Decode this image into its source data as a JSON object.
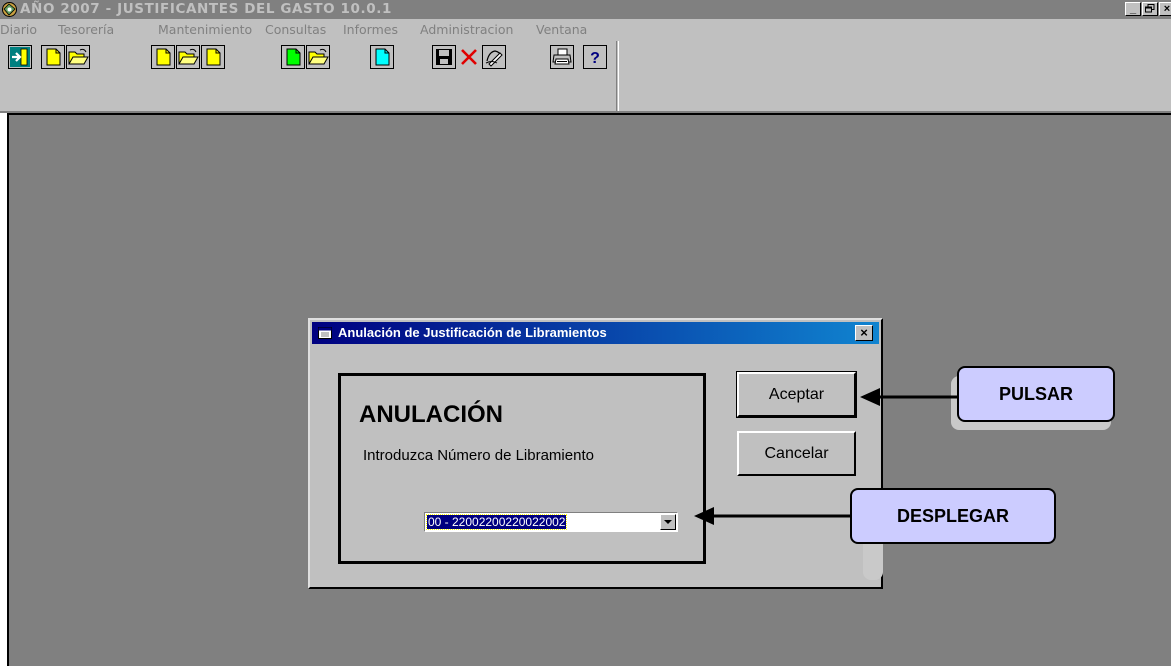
{
  "window": {
    "title": "AÑO 2007 - JUSTIFICANTES DEL GASTO 10.0.1",
    "controls": [
      "_",
      "🗗",
      "×"
    ]
  },
  "menu": [
    "Diario",
    "Tesorería",
    "Mantenimiento",
    "Consultas",
    "Informes",
    "Administracion",
    "Ventana"
  ],
  "toolbar": {
    "buttons": [
      "exit-icon",
      "new-document-icon",
      "open-folder-icon",
      "new-document-icon",
      "open-folder-icon",
      "new-document-icon",
      "new-document-green-icon",
      "open-folder-icon",
      "new-document-cyan-icon",
      "save-icon",
      "delete-icon",
      "edit-icon",
      "print-icon",
      "help-icon"
    ]
  },
  "dialog": {
    "title": "Anulación de Justificación de Libramientos",
    "close": "×",
    "heading": "ANULACIÓN",
    "prompt": "Introduzca Número de Libramiento",
    "combo_value": "00 - 22002200220022002",
    "accept_label": "Aceptar",
    "cancel_label": "Cancelar"
  },
  "callouts": {
    "pulsar": "PULSAR",
    "desplegar": "DESPLEGAR"
  },
  "colors": {
    "titlebar": "#808080",
    "face": "#c0c0c0",
    "workspace": "#808080",
    "dialog_title_start": "#000080",
    "callout_fill": "#ccccff"
  }
}
